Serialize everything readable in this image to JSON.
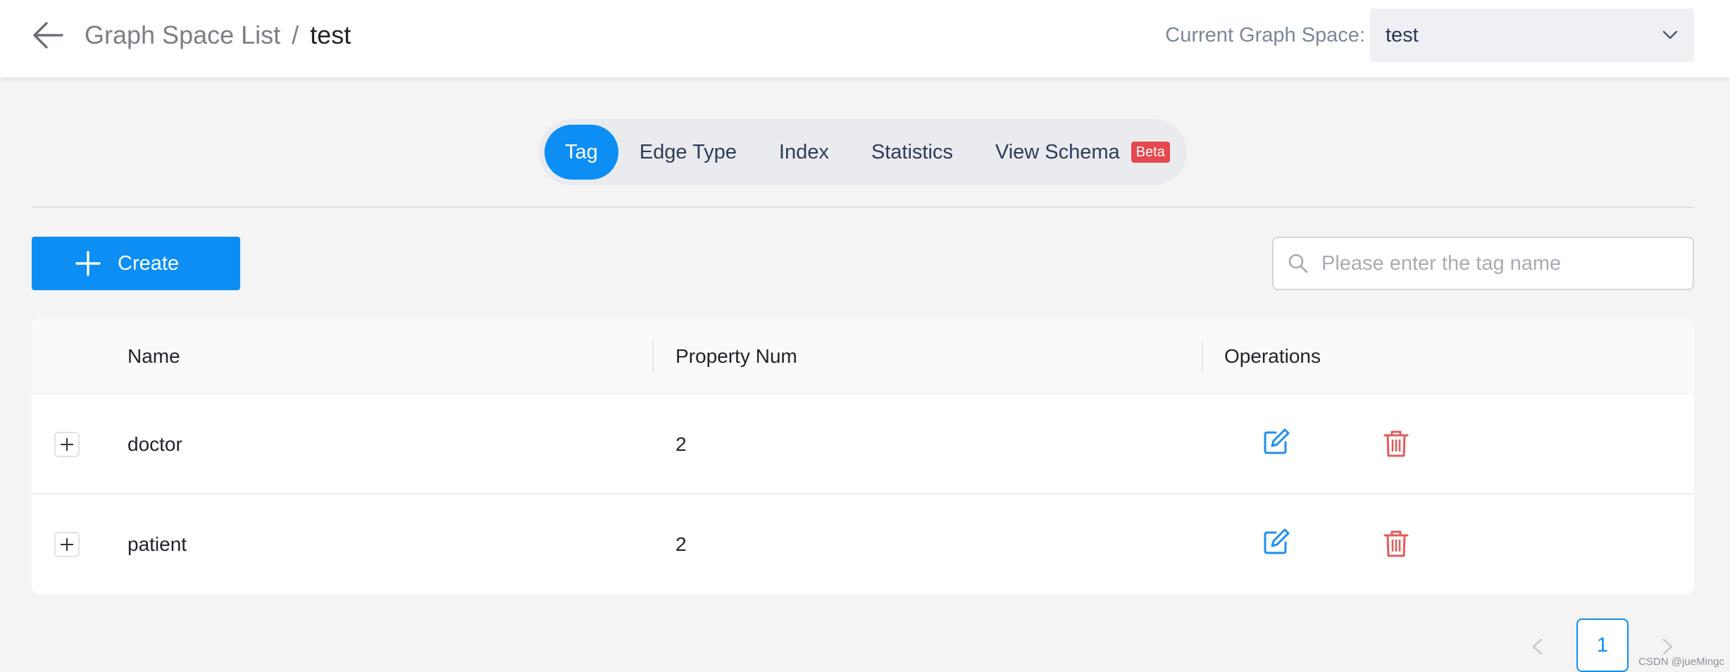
{
  "header": {
    "breadcrumb_parent": "Graph Space List",
    "breadcrumb_separator": "/",
    "breadcrumb_current": "test",
    "space_label": "Current Graph Space:",
    "space_value": "test"
  },
  "tabs": [
    {
      "label": "Tag",
      "active": true
    },
    {
      "label": "Edge Type",
      "active": false
    },
    {
      "label": "Index",
      "active": false
    },
    {
      "label": "Statistics",
      "active": false
    },
    {
      "label": "View Schema",
      "active": false,
      "badge": "Beta"
    }
  ],
  "toolbar": {
    "create_label": "Create",
    "search_placeholder": "Please enter the tag name"
  },
  "table": {
    "columns": [
      "Name",
      "Property Num",
      "Operations"
    ],
    "rows": [
      {
        "name": "doctor",
        "property_num": "2"
      },
      {
        "name": "patient",
        "property_num": "2"
      }
    ]
  },
  "pagination": {
    "current_page": "1"
  },
  "watermark": "CSDN @jueMingc",
  "colors": {
    "accent": "#0d8ef5",
    "danger": "#e5484d",
    "delete_icon": "#e25c5c"
  }
}
